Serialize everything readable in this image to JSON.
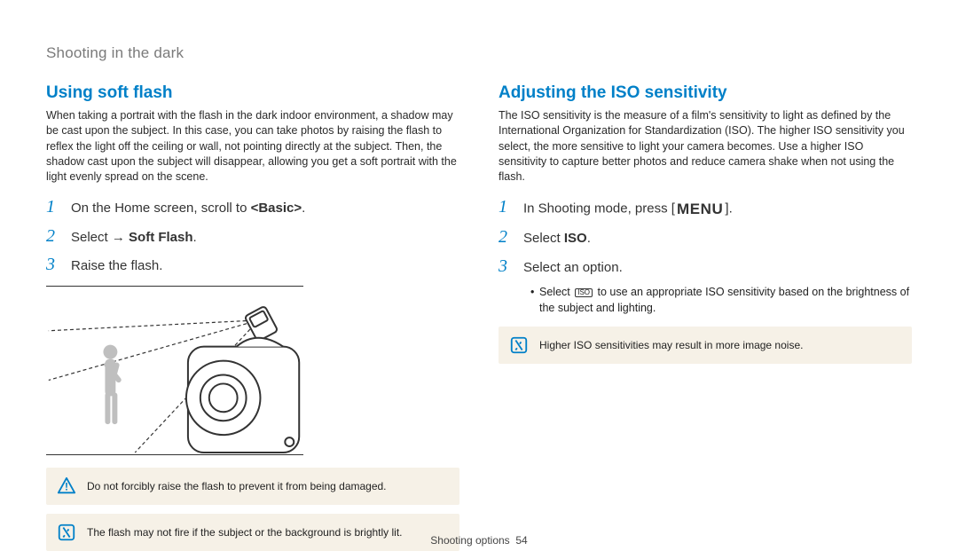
{
  "header": {
    "title": "Shooting in the dark"
  },
  "footer": {
    "section": "Shooting options",
    "page": "54"
  },
  "left": {
    "heading": "Using soft flash",
    "body": "When taking a portrait with the flash in the dark indoor environment, a shadow may be cast upon the subject. In this case, you can take photos by raising the flash to reflex the light off the ceiling or wall, not pointing directly at the subject. Then, the shadow cast upon the subject will disappear, allowing you get a soft portrait with the light evenly spread on the scene.",
    "steps": [
      {
        "num": "1",
        "pre": "On the Home screen, scroll to ",
        "bold": "<Basic>",
        "post": "."
      },
      {
        "num": "2",
        "pre": "Select ",
        "arrow": " → ",
        "bold": "Soft Flash",
        "post": "."
      },
      {
        "num": "3",
        "pre": "Raise the flash."
      }
    ],
    "warning": "Do not forcibly raise the flash to prevent it from being damaged.",
    "note": "The flash may not fire if the subject or the background is brightly lit."
  },
  "right": {
    "heading": "Adjusting the ISO sensitivity",
    "body": "The ISO sensitivity is the measure of a film's sensitivity to light as defined by the International Organization for Standardization (ISO). The higher ISO sensitivity you select, the more sensitive to light your camera becomes. Use a higher ISO sensitivity to capture better photos and reduce camera shake when not using the flash.",
    "steps": [
      {
        "num": "1",
        "pre": "In Shooting mode, press [",
        "menu": "MENU",
        "post": "]."
      },
      {
        "num": "2",
        "pre": "Select ",
        "bold": "ISO",
        "post": "."
      },
      {
        "num": "3",
        "pre": "Select an option."
      }
    ],
    "sub_pre": "Select ",
    "iso_label": "ISO",
    "sub_post": " to use an appropriate ISO sensitivity based on the brightness of the subject and lighting.",
    "note": "Higher ISO sensitivities may result in more image noise."
  }
}
